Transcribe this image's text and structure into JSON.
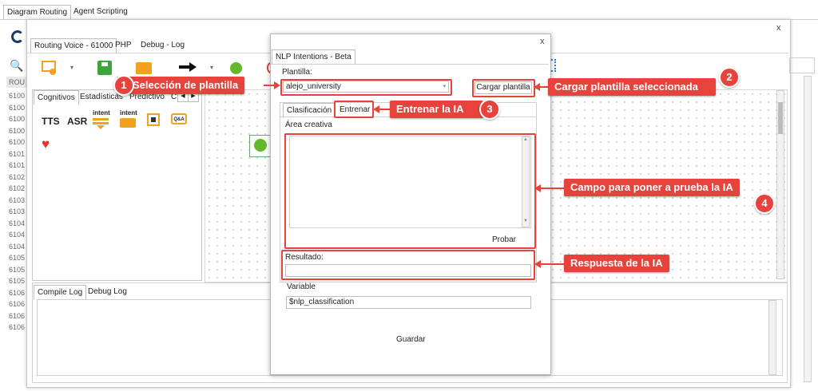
{
  "top_tabs": [
    "Diagram Routing",
    "Agent Scripting"
  ],
  "main_window": {
    "close": "x",
    "tabs": [
      "Routing Voice - 61000",
      "PHP",
      "Debug - Log"
    ],
    "column_header": "ROU",
    "row_numbers": [
      "6100",
      "6100",
      "6100",
      "6100",
      "6100",
      "6101",
      "6101",
      "6102",
      "6102",
      "6103",
      "6103",
      "6104",
      "6104",
      "6104",
      "6105",
      "6105",
      "6105",
      "6106",
      "6106",
      "6106",
      "6106"
    ]
  },
  "palette": {
    "tabs": [
      "Cognitivos",
      "Estadísticas",
      "Predictivo",
      "C"
    ],
    "nav_left": "◀",
    "nav_right": "▶",
    "items": [
      "TTS",
      "ASR",
      "intent",
      "intent"
    ],
    "chip_label": "Q&A"
  },
  "bottom": {
    "tabs": [
      "Compile Log",
      "Debug Log"
    ]
  },
  "dialog": {
    "title_tab": "NLP Intentions - Beta",
    "close": "x",
    "plantilla_label": "Plantilla:",
    "plantilla_value": "alejo_university",
    "cargar_button": "Cargar plantilla",
    "tabs": [
      "Clasificación",
      "Entrenar"
    ],
    "area_label": "Área creativa",
    "probar_button": "Probar",
    "resultado_label": "Resultado:",
    "variable_label": "Variable",
    "variable_value": "$nlp_classification",
    "guardar_button": "Guardar"
  },
  "callouts": [
    {
      "num": "1",
      "text": "Selección de plantilla"
    },
    {
      "num": "2",
      "text": "Cargar plantilla seleccionada"
    },
    {
      "num": "3",
      "text": "Entrenar la IA"
    },
    {
      "num": "4",
      "text": "Campo para poner a prueba la IA"
    },
    {
      "text": "Respuesta de la IA"
    }
  ],
  "colors": {
    "accent_red": "#e8423c",
    "green": "#62b82a",
    "orange": "#f0a21e",
    "toolbar_blue": "#2f80c8"
  }
}
